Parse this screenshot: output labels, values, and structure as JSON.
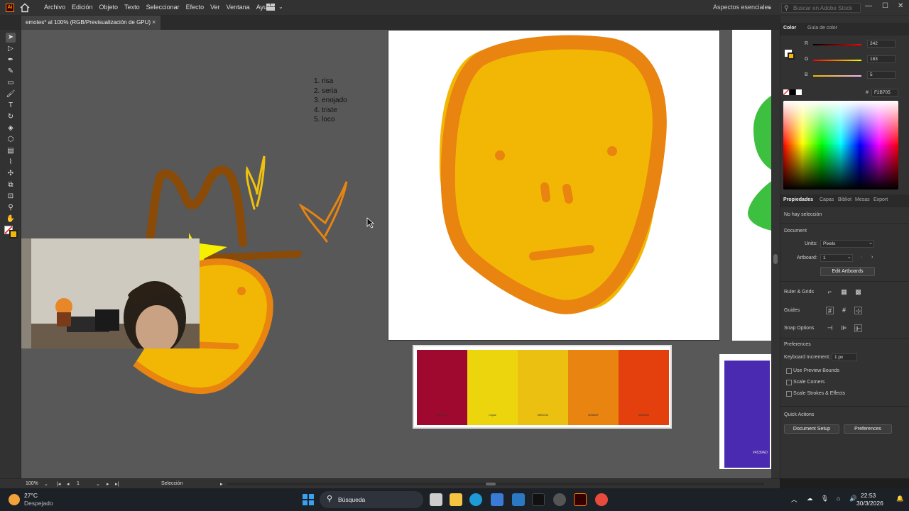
{
  "menubar": {
    "menus": [
      "Archivo",
      "Edición",
      "Objeto",
      "Texto",
      "Seleccionar",
      "Efecto",
      "Ver",
      "Ventana",
      "Ayuda"
    ],
    "workspace": "Aspectos esenciales",
    "stock_placeholder": "Buscar en Adobe Stock",
    "logo": "Ai"
  },
  "doc_tab": {
    "title": "emotes* al 100% (RGB/Previsualización de GPU)",
    "close": "×"
  },
  "canvas": {
    "list": [
      "1. risa",
      "2. seria",
      "3. enojado",
      "4. triste",
      "5. loco"
    ],
    "palette": [
      {
        "color": "#A0092F",
        "code": "#A0092F"
      },
      {
        "color": "#EDD50E",
        "code": "Copiar"
      },
      {
        "color": "#EBC010",
        "code": "#EBC010"
      },
      {
        "color": "#E8840F",
        "code": "#E8840F"
      },
      {
        "color": "#E3400D",
        "code": "#E3400D"
      }
    ],
    "purple_code": "#4539AD"
  },
  "panel": {
    "tabs": [
      "Color",
      "Guía de color"
    ],
    "channels": [
      {
        "label": "R",
        "value": "242"
      },
      {
        "label": "G",
        "value": "183"
      },
      {
        "label": "B",
        "value": "5"
      }
    ],
    "hex_label": "#",
    "hex": "F2B705",
    "prop_tabs": [
      "Propiedades",
      "Capas",
      "Bibliot",
      "Mesas",
      "Export"
    ],
    "no_selection": "No hay selección",
    "document": "Document",
    "units_label": "Units:",
    "units_value": "Pixels",
    "artboard_label": "Artboard:",
    "artboard_value": "1",
    "edit_artboards": "Edit Artboards",
    "ruler_grids": "Ruler & Grids",
    "guides": "Guides",
    "snap_options": "Snap Options",
    "preferences": "Preferences",
    "keyboard_increment": "Keyboard Increment:",
    "keyboard_value": "1 px",
    "checkboxes": [
      "Use Preview Bounds",
      "Scale Corners",
      "Scale Strokes & Effects"
    ],
    "quick_actions": "Quick Actions",
    "document_setup": "Document Setup",
    "preferences_btn": "Preferences"
  },
  "statusbar": {
    "zoom": "100%",
    "artboard": "1",
    "tool": "Selección"
  },
  "taskbar": {
    "temp": "27°C",
    "weather": "Despejado",
    "search": "Búsqueda",
    "time": "22:53",
    "date": "30/3/2026"
  }
}
